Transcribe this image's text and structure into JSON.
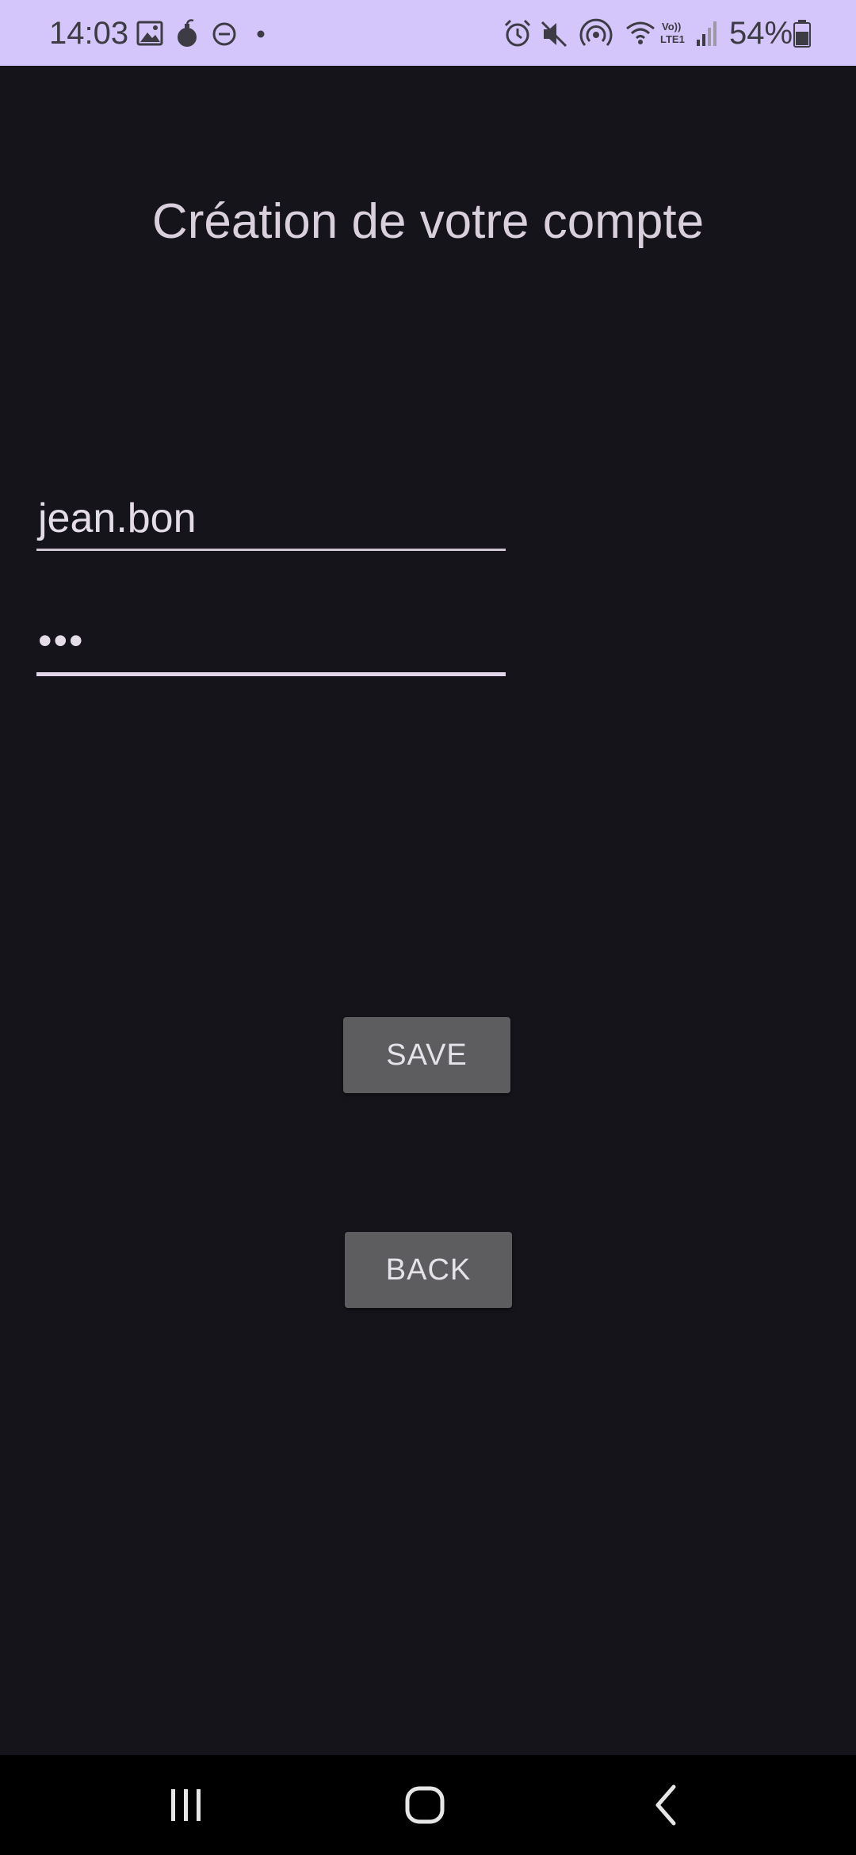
{
  "status_bar": {
    "time": "14:03",
    "battery_percent": "54%",
    "background_color": "#d4c6fb",
    "left_icons": [
      "gallery-icon",
      "bomb-icon",
      "do-not-disturb-icon",
      "dot-icon"
    ],
    "right_icons": [
      "alarm-icon",
      "mute-icon",
      "hotspot-icon",
      "wifi-icon",
      "volte-lte-icon",
      "signal-icon",
      "battery-icon"
    ],
    "volte_label": "Vo)) LTE1"
  },
  "page": {
    "title": "Création de votre compte"
  },
  "form": {
    "username_value": "jean.bon",
    "password_value": "•••"
  },
  "buttons": {
    "save_label": "SAVE",
    "back_label": "BACK",
    "button_color": "#5d5d5f"
  },
  "nav_bar": {
    "icons": [
      "recent-apps-icon",
      "home-icon",
      "back-nav-icon"
    ]
  },
  "colors": {
    "background": "#15141a",
    "text": "#d9cfdd",
    "underline": "#cfc6d2"
  }
}
